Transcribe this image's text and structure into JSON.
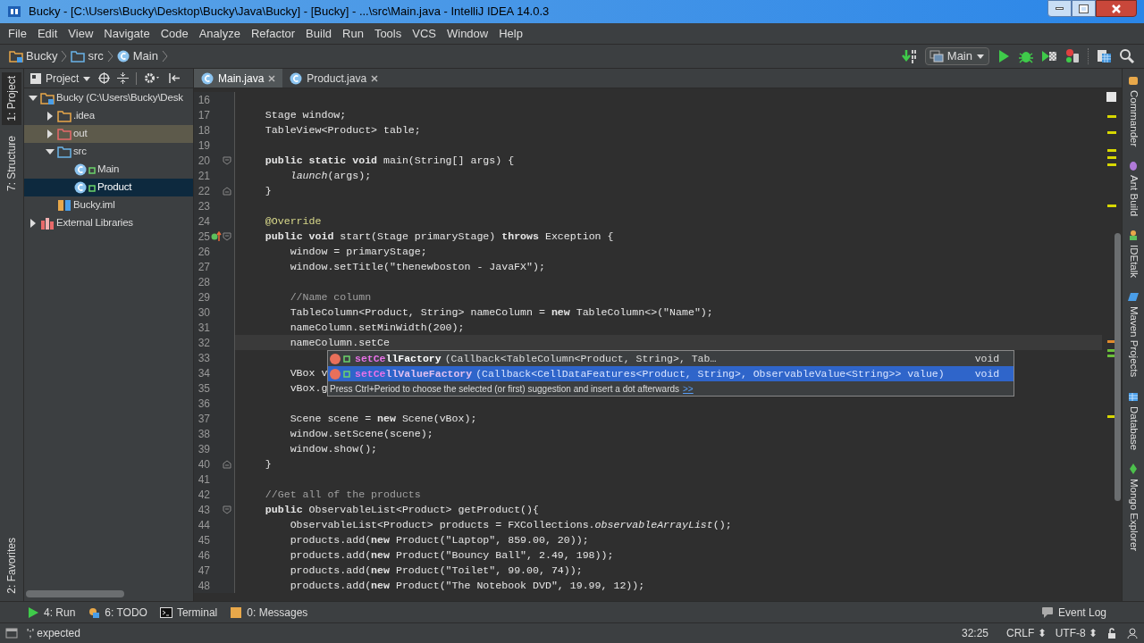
{
  "window": {
    "title": "Bucky - [C:\\Users\\Bucky\\Desktop\\Bucky\\Java\\Bucky] - [Bucky] - ...\\src\\Main.java - IntelliJ IDEA 14.0.3"
  },
  "menu": [
    "File",
    "Edit",
    "View",
    "Navigate",
    "Code",
    "Analyze",
    "Refactor",
    "Build",
    "Run",
    "Tools",
    "VCS",
    "Window",
    "Help"
  ],
  "breadcrumb": [
    {
      "label": "Bucky",
      "kind": "project"
    },
    {
      "label": "src",
      "kind": "folder"
    },
    {
      "label": "Main",
      "kind": "class"
    }
  ],
  "run_config": "Main",
  "left_tool_tabs": [
    {
      "label": "1: Project",
      "selected": true
    },
    {
      "label": "7: Structure",
      "selected": false
    }
  ],
  "left_bottom_tool_tabs": [
    {
      "label": "2: Favorites",
      "selected": false
    }
  ],
  "project_panel": {
    "title": "Project",
    "tree": [
      {
        "label": "Bucky (C:\\Users\\Bucky\\Desk",
        "kind": "project",
        "expanded": true,
        "selected": false,
        "children": [
          {
            "label": ".idea",
            "kind": "folder",
            "expanded": false,
            "selected": false
          },
          {
            "label": "out",
            "kind": "excluded",
            "expanded": false,
            "selected": false
          },
          {
            "label": "src",
            "kind": "source",
            "expanded": true,
            "selected": false,
            "children": [
              {
                "label": "Main",
                "kind": "class",
                "selected": false
              },
              {
                "label": "Product",
                "kind": "class",
                "selected": true
              }
            ]
          },
          {
            "label": "Bucky.iml",
            "kind": "module",
            "selected": false
          }
        ]
      },
      {
        "label": "External Libraries",
        "kind": "library",
        "expanded": false,
        "selected": false
      }
    ]
  },
  "editor_tabs": [
    {
      "label": "Main.java",
      "selected": true
    },
    {
      "label": "Product.java",
      "selected": false
    }
  ],
  "code": [
    {
      "num": "16"
    },
    {
      "num": "17",
      "text": "    Stage window;"
    },
    {
      "num": "18",
      "text": "    TableView<Product> table;"
    },
    {
      "num": "19"
    },
    {
      "num": "20",
      "text": "    **public static void** main(String[] args) {",
      "fold_start": true
    },
    {
      "num": "21",
      "text": "        *launch*(args);"
    },
    {
      "num": "22",
      "text": "    }",
      "fold_end": true
    },
    {
      "num": "23"
    },
    {
      "num": "24",
      "text": "    @Override",
      "kind": "annotation"
    },
    {
      "num": "25",
      "text": "    **public void** start(Stage primaryStage) **throws** Exception {",
      "fold_start": true,
      "override": true
    },
    {
      "num": "26",
      "text": "        window = primaryStage;"
    },
    {
      "num": "27",
      "text": "        window.setTitle(\"thenewboston - JavaFX\");"
    },
    {
      "num": "28"
    },
    {
      "num": "29",
      "text": "        //Name column",
      "kind": "comment"
    },
    {
      "num": "30",
      "text": "        TableColumn<Product, String> nameColumn = **new** TableColumn<>(\"Name\");"
    },
    {
      "num": "31",
      "text": "        nameColumn.setMinWidth(200);"
    },
    {
      "num": "32",
      "text": "        nameColumn.setCe",
      "current": true
    },
    {
      "num": "33"
    },
    {
      "num": "34",
      "text": "        VBox v"
    },
    {
      "num": "35",
      "text": "        vBox.g"
    },
    {
      "num": "36"
    },
    {
      "num": "37",
      "text": "        Scene scene = **new** Scene(vBox);"
    },
    {
      "num": "38",
      "text": "        window.setScene(scene);"
    },
    {
      "num": "39",
      "text": "        window.show();"
    },
    {
      "num": "40",
      "text": "    }",
      "fold_end": true
    },
    {
      "num": "41"
    },
    {
      "num": "42",
      "text": "    //Get all of the products",
      "kind": "comment"
    },
    {
      "num": "43",
      "text": "    **public** ObservableList<Product> getProduct(){",
      "fold_start": true
    },
    {
      "num": "44",
      "text": "        ObservableList<Product> products = FXCollections.*observableArrayList*();"
    },
    {
      "num": "45",
      "text": "        products.add(**new** Product(\"Laptop\", 859.00, 20));"
    },
    {
      "num": "46",
      "text": "        products.add(**new** Product(\"Bouncy Ball\", 2.49, 198));"
    },
    {
      "num": "47",
      "text": "        products.add(**new** Product(\"Toilet\", 99.00, 74));"
    },
    {
      "num": "48",
      "text": "        products.add(**new** Product(\"The Notebook DVD\", 19.99, 12));"
    }
  ],
  "completion": {
    "items": [
      {
        "match": "setCe",
        "rest": "llFactory",
        "signature": "(Callback<TableColumn<Product, String>, Tab…",
        "type": "void",
        "selected": false
      },
      {
        "match": "setCe",
        "rest": "llValueFactory",
        "signature": "(Callback<CellDataFeatures<Product, String>, ObservableValue<String>> value)",
        "type": "void",
        "selected": true
      }
    ],
    "hint": "Press Ctrl+Period to choose the selected (or first) suggestion and insert a dot afterwards",
    "hint_link": ">>"
  },
  "right_tool_tabs": [
    "Commander",
    "Ant Build",
    "IDEtalk",
    "Maven Projects",
    "Database",
    "Mongo Explorer"
  ],
  "bottom_tool_tabs": [
    {
      "label": "4: Run",
      "kind": "run"
    },
    {
      "label": "6: TODO",
      "kind": "todo"
    },
    {
      "label": "Terminal",
      "kind": "terminal"
    },
    {
      "label": "0: Messages",
      "kind": "messages"
    }
  ],
  "event_log": "Event Log",
  "status_bar": {
    "message": "';' expected",
    "position": "32:25",
    "line_separator": "CRLF ⬍",
    "encoding": "UTF-8 ⬍"
  }
}
